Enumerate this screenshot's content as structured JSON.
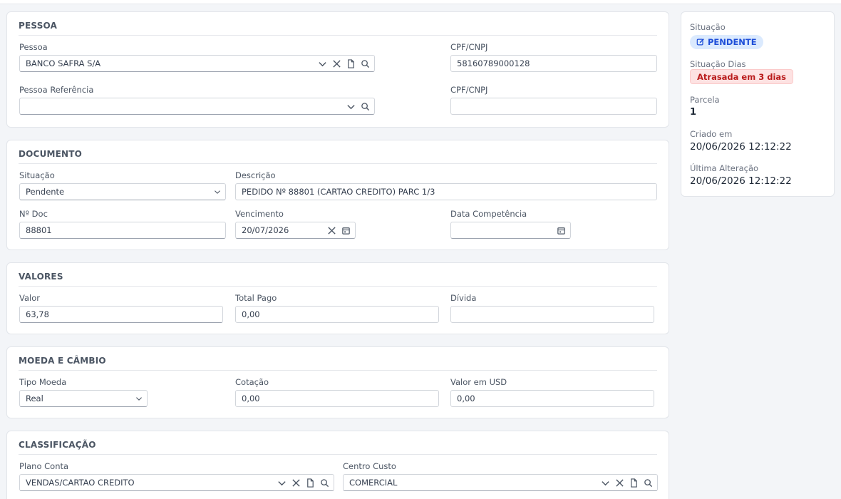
{
  "pessoa_section": {
    "title": "PESSOA",
    "pessoa_label": "Pessoa",
    "pessoa_value": "BANCO SAFRA S/A",
    "cpf_label": "CPF/CNPJ",
    "cpf_value": "58160789000128",
    "ref_label": "Pessoa Referência",
    "ref_value": "",
    "cpf2_label": "CPF/CNPJ",
    "cpf2_value": ""
  },
  "documento_section": {
    "title": "DOCUMENTO",
    "situacao_label": "Situação",
    "situacao_value": "Pendente",
    "descricao_label": "Descrição",
    "descricao_value": "PEDIDO Nº 88801 (CARTAO CREDITO) PARC 1/3",
    "ndoc_label": "Nº Doc",
    "ndoc_value": "88801",
    "vencimento_label": "Vencimento",
    "vencimento_value": "20/07/2026",
    "competencia_label": "Data Competência",
    "competencia_value": ""
  },
  "valores_section": {
    "title": "VALORES",
    "valor_label": "Valor",
    "valor_value": "63,78",
    "totalpago_label": "Total Pago",
    "totalpago_value": "0,00",
    "divida_label": "Dívida",
    "divida_value": ""
  },
  "moeda_section": {
    "title": "MOEDA E CÂMBIO",
    "tipo_label": "Tipo Moeda",
    "tipo_value": "Real",
    "cotacao_label": "Cotação",
    "cotacao_value": "0,00",
    "usd_label": "Valor em USD",
    "usd_value": "0,00"
  },
  "classificacao_section": {
    "title": "CLASSIFICAÇÃO",
    "plano_label": "Plano Conta",
    "plano_value": "VENDAS/CARTAO CREDITO",
    "centro_label": "Centro Custo",
    "centro_value": "COMERCIAL"
  },
  "sidebar": {
    "situacao_label": "Situação",
    "situacao_badge": "PENDENTE",
    "situacao_dias_label": "Situação Dias",
    "situacao_dias_badge": "Atrasada em 3 dias",
    "parcela_label": "Parcela",
    "parcela_value": "1",
    "criado_label": "Criado em",
    "criado_value": "20/06/2026 12:12:22",
    "alteracao_label": "Última Alteração",
    "alteracao_value": "20/06/2026 12:12:22"
  }
}
